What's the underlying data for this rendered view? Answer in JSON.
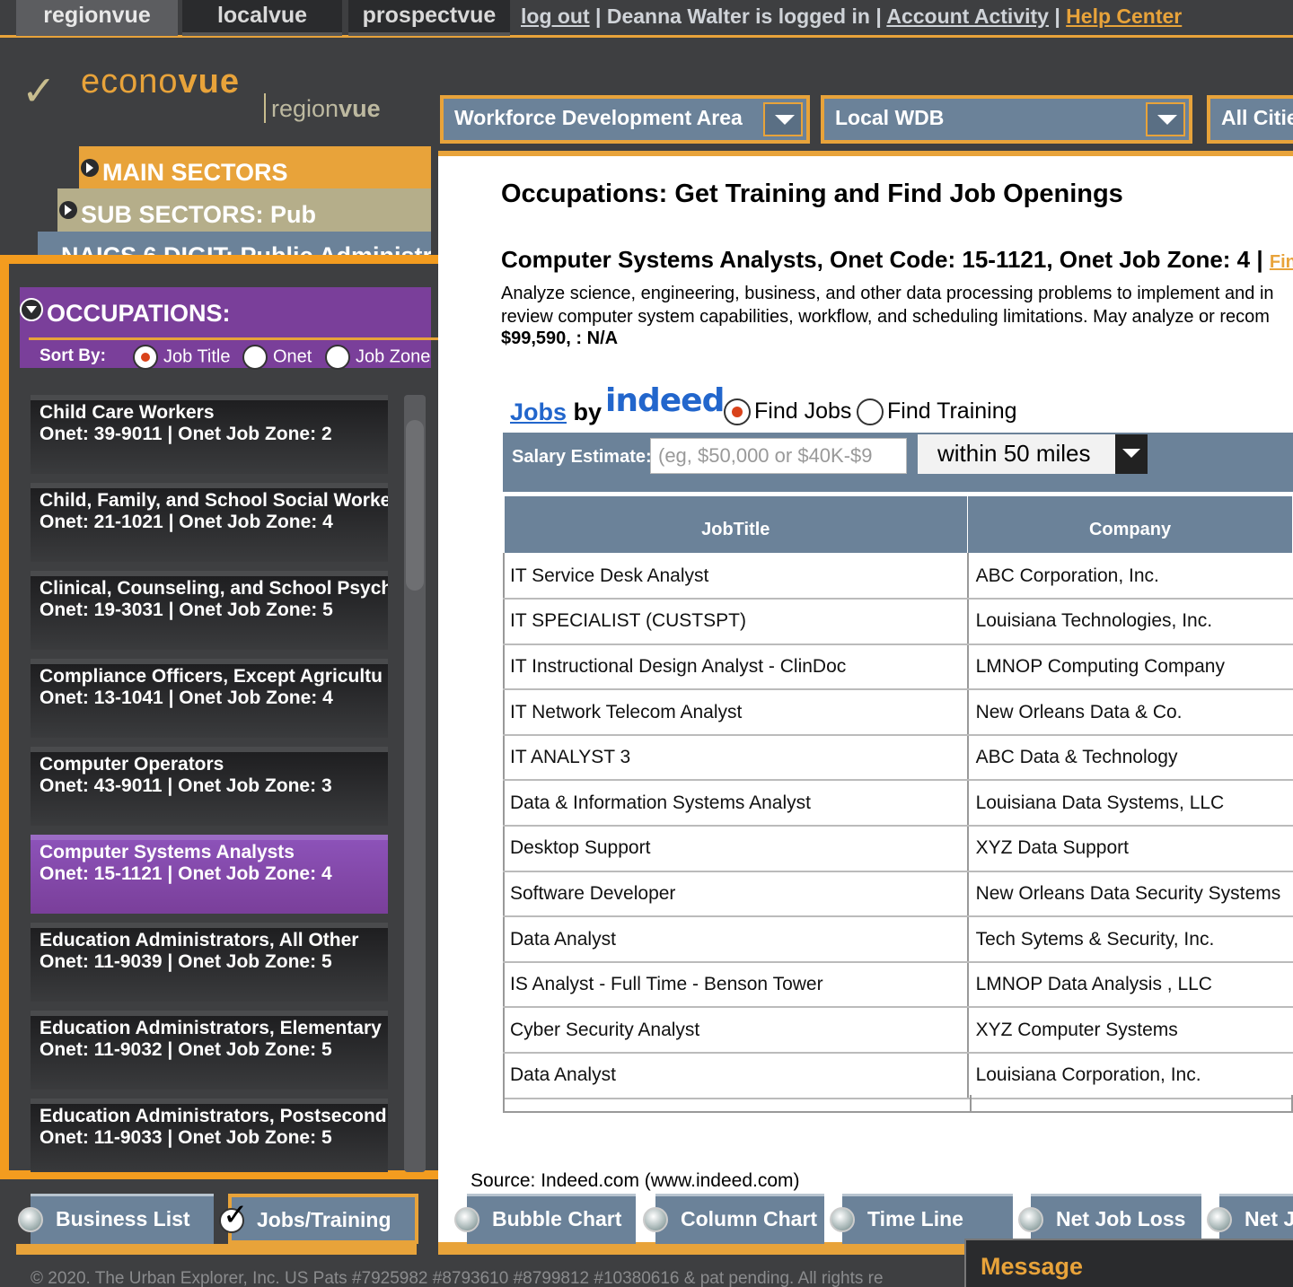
{
  "topnav": {
    "tabs": [
      "regionvue",
      "localvue",
      "prospectvue"
    ],
    "logout": "log out",
    "user_text": "Deanna Walter is logged in",
    "account": "Account Activity",
    "help": "Help Center"
  },
  "logo": {
    "brand_light": "econo",
    "brand_bold": "vue",
    "sub_light": "region",
    "sub_bold": "vue"
  },
  "filters": {
    "area_type": "Workforce Development Area",
    "area": "Local WDB",
    "cities": "All Citie"
  },
  "left": {
    "main_sectors": "MAIN SECTORS",
    "sub_sectors": "SUB SECTORS: Pub",
    "naics": "NAICS 6 DIGIT: Public Administr",
    "occupations_title": "OCCUPATIONS:",
    "sort_by": "Sort By:",
    "sort_options": [
      "Job Title",
      "Onet",
      "Job Zone"
    ],
    "sort_selected": "Job Title",
    "occupations": [
      {
        "title": "Child Care Workers",
        "code": "Onet: 39-9011 | Onet Job Zone: 2"
      },
      {
        "title": "Child, Family, and School Social Worke",
        "code": "Onet: 21-1021 | Onet Job Zone: 4"
      },
      {
        "title": "Clinical, Counseling, and School Psych",
        "code": "Onet: 19-3031 | Onet Job Zone: 5"
      },
      {
        "title": "Compliance Officers, Except Agricultu",
        "code": "Onet: 13-1041 | Onet Job Zone: 4"
      },
      {
        "title": "Computer Operators",
        "code": "Onet: 43-9011 | Onet Job Zone: 3"
      },
      {
        "title": "Computer Systems Analysts",
        "code": "Onet: 15-1121 | Onet Job Zone: 4"
      },
      {
        "title": "Education Administrators, All Other",
        "code": "Onet: 11-9039 | Onet Job Zone: 5"
      },
      {
        "title": "Education Administrators, Elementary",
        "code": "Onet: 11-9032 | Onet Job Zone: 5"
      },
      {
        "title": "Education Administrators, Postsecond",
        "code": "Onet: 11-9033 | Onet Job Zone: 5"
      }
    ],
    "selected_occupation": "Computer Systems Analysts"
  },
  "main": {
    "page_title": "Occupations: Get Training and Find Job Openings",
    "occ_heading": "Computer Systems Analysts, Onet Code: 15-1121, Onet Job Zone: 4",
    "occ_link": "Find o",
    "occ_desc_1": "Analyze science, engineering, business, and other data processing problems to implement and in",
    "occ_desc_2": "review computer system capabilities, workflow, and scheduling limitations. May analyze or recom",
    "occ_salary": "$99,590, : N/A",
    "jobs_link": "Jobs",
    "by": "by",
    "indeed": "indeed",
    "find_jobs": "Find Jobs",
    "find_training": "Find Training",
    "salary_label": "Salary Estimate:",
    "salary_placeholder": "(eg, $50,000 or $40K-$9",
    "distance": "within 50 miles",
    "table": {
      "headers": [
        "JobTitle",
        "Company"
      ],
      "rows": [
        [
          "IT Service Desk Analyst",
          "ABC Corporation, Inc."
        ],
        [
          "IT SPECIALIST (CUSTSPT)",
          "Louisiana Technologies, Inc."
        ],
        [
          "IT Instructional Design Analyst - ClinDoc",
          "LMNOP Computing Company"
        ],
        [
          "IT Network Telecom Analyst",
          "New Orleans Data & Co."
        ],
        [
          "IT ANALYST 3",
          "ABC Data & Technology"
        ],
        [
          "Data & Information Systems Analyst",
          "Louisiana Data Systems, LLC"
        ],
        [
          "Desktop Support",
          "XYZ Data Support"
        ],
        [
          "Software Developer",
          "New Orleans Data Security Systems"
        ],
        [
          "Data Analyst",
          "Tech Sytems & Security, Inc."
        ],
        [
          "IS Analyst - Full Time - Benson Tower",
          "LMNOP Data Analysis , LLC"
        ],
        [
          "Cyber Security Analyst",
          "XYZ Computer Systems"
        ],
        [
          "Data Analyst",
          "Louisiana Corporation, Inc."
        ]
      ]
    },
    "source": "Source: Indeed.com (www.indeed.com)"
  },
  "bottom": {
    "business_list": "Business List",
    "jobs_training": "Jobs/Training",
    "bubble": "Bubble Chart",
    "column": "Column Chart",
    "timeline": "Time Line",
    "netloss": "Net Job Loss",
    "netj": "Net J",
    "copyright": "© 2020. The Urban Explorer, Inc. US Pats #7925982 #8793610 #8799812 #10380616 & pat pending. All rights re",
    "message": "Message"
  },
  "colors": {
    "accent": "#e8a33a",
    "highlight": "#f39c1f",
    "purple": "#7a3f9a",
    "slate": "#6b8299",
    "bg": "#3e3f41"
  }
}
